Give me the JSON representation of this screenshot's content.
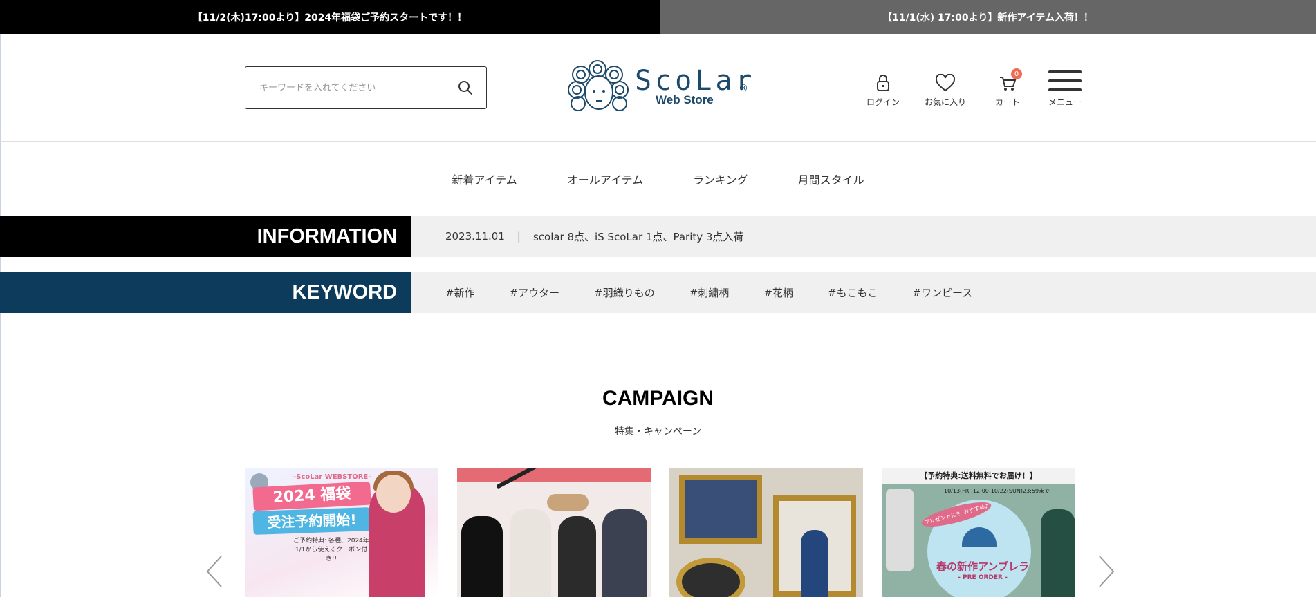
{
  "announcements": [
    "【11/2(木)17:00より】2024年福袋ご予約スタートです！！",
    "【11/1(水) 17:00より】新作アイテム入荷！！"
  ],
  "search": {
    "placeholder": "キーワードを入れてください",
    "icon": "search-icon"
  },
  "logo": {
    "script": "ScoLar",
    "sub": "Web Store",
    "reg": "®"
  },
  "header_icons": [
    {
      "label": "ログイン",
      "icon": "lock-icon"
    },
    {
      "label": "お気に入り",
      "icon": "heart-icon"
    },
    {
      "label": "カート",
      "icon": "cart-icon",
      "badge": "0"
    },
    {
      "label": "メニュー",
      "icon": "hamburger-icon"
    }
  ],
  "nav": [
    "新着アイテム",
    "オールアイテム",
    "ランキング",
    "月間スタイル"
  ],
  "information": {
    "heading": "INFORMATION",
    "date": "2023.11.01",
    "separator": "|",
    "text": "scolar 8点、iS ScoLar 1点、Parity 3点入荷"
  },
  "keyword": {
    "heading": "KEYWORD",
    "tags": [
      "#新作",
      "#アウター",
      "#羽織りもの",
      "#刺繍柄",
      "#花柄",
      "#もこもこ",
      "#ワンピース"
    ]
  },
  "campaign": {
    "title": "CAMPAIGN",
    "subtitle": "特集・キャンペーン",
    "cards": [
      {
        "brand": "-ScoLar WEBSTORE-",
        "line1": "2024 福袋",
        "line2": "受注予約開始!",
        "note": "ご予約特典: 各種、2024年1/1から使えるクーポン付き!!"
      },
      {},
      {},
      {
        "ribbon": "【予約特典:送料無料でお届け！】",
        "date": "10/13(FRI)12:00-10/22(SUN)23:59まで",
        "title": "春の新作アンブレラ",
        "sub": "- PRE ORDER -",
        "promo": "プレゼントにも おすすめ♪"
      }
    ]
  },
  "colors": {
    "announce_left": "#000000",
    "announce_right": "#666666",
    "information_head": "#000000",
    "keyword_head": "#0d3b5c",
    "brand": "#1d4a6a",
    "badge": "#ee6b55"
  }
}
